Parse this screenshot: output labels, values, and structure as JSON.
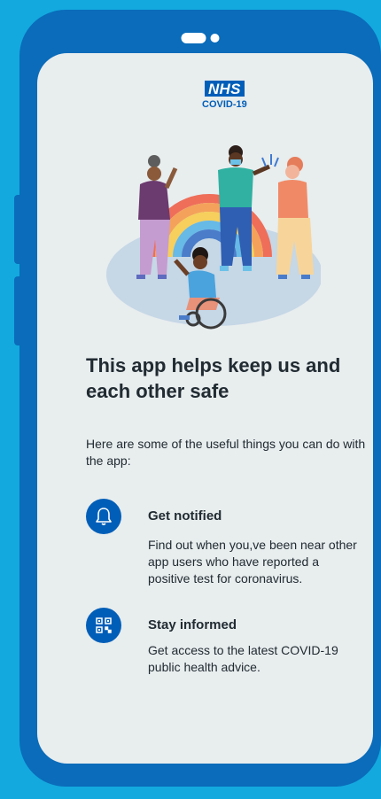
{
  "logo": {
    "brand": "NHS",
    "subtitle": "COVID-19"
  },
  "title": "This app helps keep us and each other safe",
  "intro": "Here are some of the useful things you can do with the app:",
  "features": [
    {
      "icon": "bell-icon",
      "title": "Get notified",
      "description": "Find out when you,ve been near other app users who have reported a positive test for coronavirus."
    },
    {
      "icon": "qr-code-icon",
      "title": "Stay informed",
      "description": "Get access to the latest COVID-19 public health advice."
    }
  ],
  "colors": {
    "background": "#13a9df",
    "phone_frame": "#0a6cba",
    "screen": "#e8edee",
    "nhs_blue": "#005eb8",
    "text": "#212b32"
  }
}
